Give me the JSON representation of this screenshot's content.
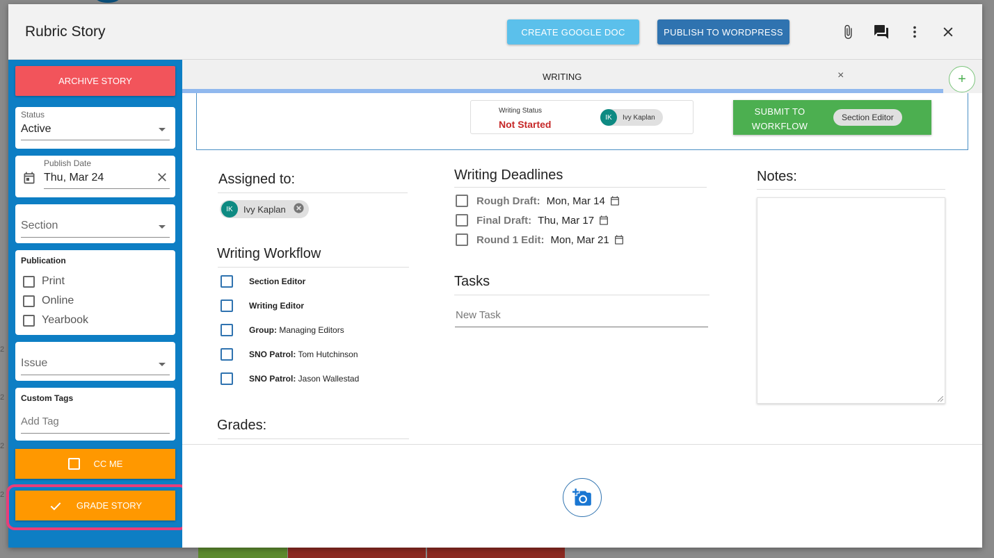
{
  "modal": {
    "title": "Rubric Story",
    "create_gdoc_label": "CREATE GOOGLE DOC",
    "publish_wp_label": "PUBLISH TO WORDPRESS",
    "header_icons": [
      "paperclip-icon",
      "chat-icon",
      "more-vert-icon",
      "close-icon"
    ]
  },
  "sidebar": {
    "archive_label": "ARCHIVE STORY",
    "status": {
      "label": "Status",
      "value": "Active"
    },
    "publish_date": {
      "label": "Publish Date",
      "value": "Thu, Mar 24"
    },
    "section": {
      "placeholder": "Section"
    },
    "publication": {
      "title": "Publication",
      "options": [
        "Print",
        "Online",
        "Yearbook"
      ]
    },
    "issue": {
      "placeholder": "Issue"
    },
    "custom_tags": {
      "title": "Custom Tags",
      "placeholder": "Add Tag"
    },
    "cc_me_label": "CC ME",
    "grade_story_label": "GRADE STORY"
  },
  "tab": {
    "label": "WRITING",
    "close": "×",
    "add": "+"
  },
  "writing_status": {
    "label": "Writing Status",
    "value": "Not Started",
    "assignee_initials": "IK",
    "assignee_name": "Ivy Kaplan"
  },
  "submit": {
    "label": "SUBMIT TO WORKFLOW",
    "chip": "Section Editor"
  },
  "assigned": {
    "title": "Assigned to:",
    "initials": "IK",
    "name": "Ivy Kaplan"
  },
  "workflow": {
    "title": "Writing Workflow",
    "items": [
      {
        "bold": "Section Editor",
        "rest": ""
      },
      {
        "bold": "Writing Editor",
        "rest": ""
      },
      {
        "bold": "Group:",
        "rest": " Managing Editors"
      },
      {
        "bold": "SNO Patrol:",
        "rest": " Tom Hutchinson"
      },
      {
        "bold": "SNO Patrol:",
        "rest": " Jason Wallestad"
      }
    ]
  },
  "grades": {
    "title": "Grades:"
  },
  "deadlines": {
    "title": "Writing Deadlines",
    "items": [
      {
        "name": "Rough Draft:",
        "date": "Mon, Mar 14"
      },
      {
        "name": "Final Draft:",
        "date": "Thu, Mar 17"
      },
      {
        "name": "Round 1 Edit:",
        "date": "Mon, Mar 21"
      }
    ]
  },
  "tasks": {
    "title": "Tasks",
    "placeholder": "New Task"
  },
  "notes": {
    "title": "Notes:"
  },
  "colors": {
    "sidebar": "#0d7ec4",
    "archive": "#f2545b",
    "orange": "#ff9800",
    "submit": "#4caf50",
    "highlight": "#e83e7a"
  }
}
